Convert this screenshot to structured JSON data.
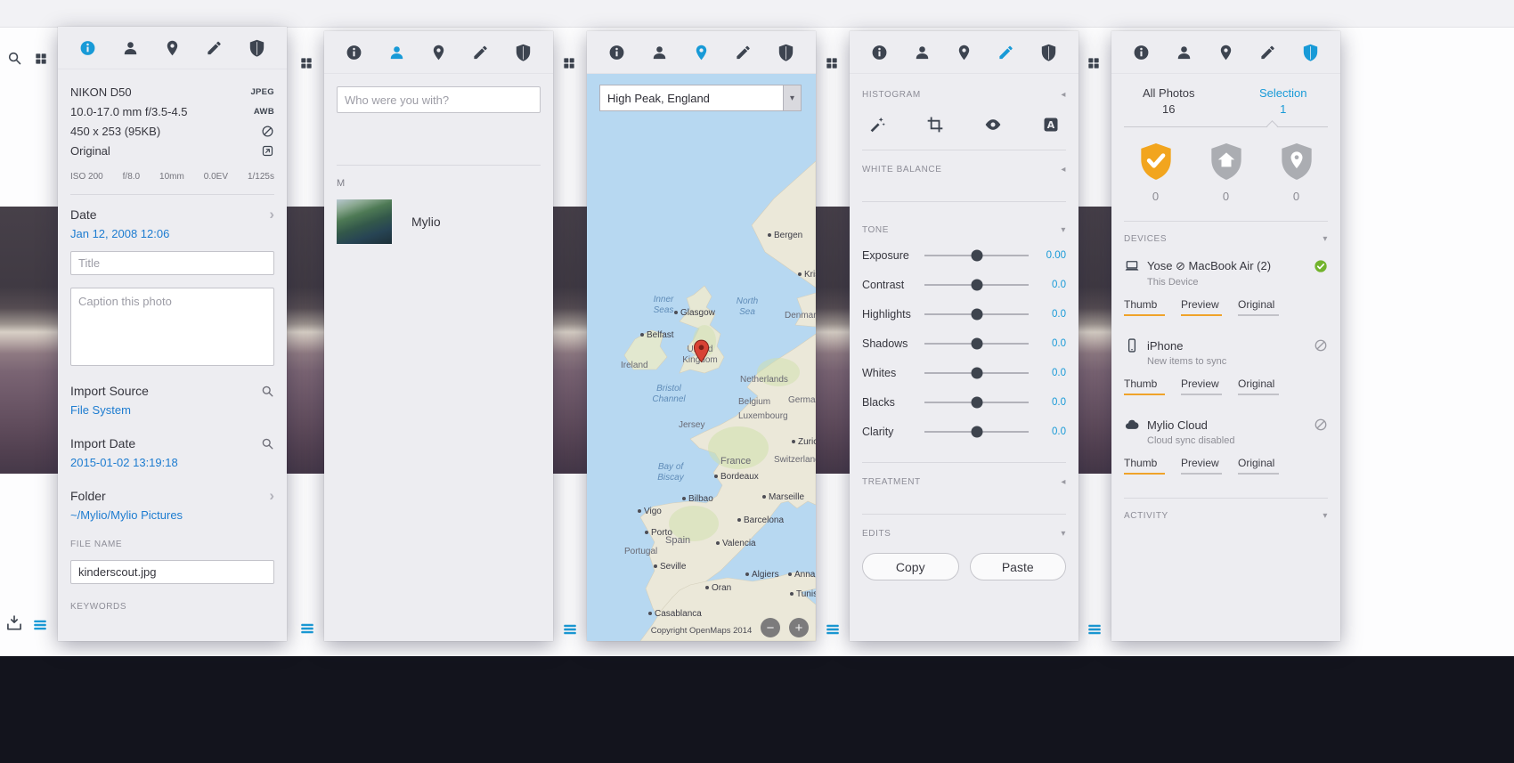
{
  "glyphs": {
    "chevron_right": "›",
    "caret_down": "▾",
    "caret_left": "◂",
    "plus": "+",
    "minus": "−"
  },
  "info": {
    "camera": "NIKON D50",
    "format_badge": "JPEG",
    "lens": "10.0-17.0 mm f/3.5-4.5",
    "wb_badge": "AWB",
    "dimensions": "450 x 253 (95KB)",
    "original_label": "Original",
    "exif": [
      "ISO 200",
      "f/8.0",
      "10mm",
      "0.0EV",
      "1/125s"
    ],
    "date_label": "Date",
    "date_value": "Jan 12, 2008 12:06",
    "title_placeholder": "Title",
    "caption_placeholder": "Caption this photo",
    "import_source_label": "Import Source",
    "import_source_value": "File System",
    "import_date_label": "Import Date",
    "import_date_value": "2015-01-02 13:19:18",
    "folder_label": "Folder",
    "folder_value": "~/Mylio/Mylio Pictures",
    "file_name_label": "FILE NAME",
    "file_name_value": "kinderscout.jpg",
    "keywords_label": "KEYWORDS"
  },
  "people": {
    "search_placeholder": "Who were you with?",
    "group_letter": "M",
    "person_name": "Mylio"
  },
  "map": {
    "location_value": "High Peak, England",
    "copyright": "Copyright OpenMaps 2014",
    "labels": [
      {
        "text": "Bergen"
      },
      {
        "text": "Kristiansand"
      },
      {
        "text": "Inner Seas"
      },
      {
        "text": "Glasgow"
      },
      {
        "text": "North Sea"
      },
      {
        "text": "Denmark"
      },
      {
        "text": "Belfast"
      },
      {
        "text": "United Kingdom"
      },
      {
        "text": "Ireland"
      },
      {
        "text": "Netherlands"
      },
      {
        "text": "Bristol Channel"
      },
      {
        "text": "Belgium"
      },
      {
        "text": "Luxembourg"
      },
      {
        "text": "Germany"
      },
      {
        "text": "Jersey"
      },
      {
        "text": "Zurich"
      },
      {
        "text": "France"
      },
      {
        "text": "Switzerland"
      },
      {
        "text": "Bay of Biscay"
      },
      {
        "text": "Bordeaux"
      },
      {
        "text": "Bilbao"
      },
      {
        "text": "Marseille"
      },
      {
        "text": "Vigo"
      },
      {
        "text": "Barcelona"
      },
      {
        "text": "Porto"
      },
      {
        "text": "Valencia"
      },
      {
        "text": "Spain"
      },
      {
        "text": "Portugal"
      },
      {
        "text": "Seville"
      },
      {
        "text": "Algiers"
      },
      {
        "text": "Annaba"
      },
      {
        "text": "Oran"
      },
      {
        "text": "Casablanca"
      },
      {
        "text": "Tunis"
      }
    ]
  },
  "edit": {
    "histogram_label": "HISTOGRAM",
    "white_balance_label": "WHITE BALANCE",
    "tone_label": "TONE",
    "treatment_label": "TREATMENT",
    "edits_label": "EDITS",
    "tone_sliders": [
      {
        "label": "Exposure",
        "value": "0.00"
      },
      {
        "label": "Contrast",
        "value": "0.0"
      },
      {
        "label": "Highlights",
        "value": "0.0"
      },
      {
        "label": "Shadows",
        "value": "0.0"
      },
      {
        "label": "Whites",
        "value": "0.0"
      },
      {
        "label": "Blacks",
        "value": "0.0"
      },
      {
        "label": "Clarity",
        "value": "0.0"
      }
    ],
    "copy_label": "Copy",
    "paste_label": "Paste"
  },
  "sync": {
    "all_photos_label": "All Photos",
    "all_photos_count": "16",
    "selection_label": "Selection",
    "selection_count": "1",
    "shield_counts": [
      "0",
      "0",
      "0"
    ],
    "devices_label": "DEVICES",
    "devices": [
      {
        "name": "Yose ⊘ MacBook Air (2)",
        "subtitle": "This Device",
        "q1": "Thumb",
        "q2": "Preview",
        "q3": "Original"
      },
      {
        "name": "iPhone",
        "subtitle": "New items to sync",
        "q1": "Thumb",
        "q2": "Preview",
        "q3": "Original"
      },
      {
        "name": "Mylio Cloud",
        "subtitle": "Cloud sync disabled",
        "q1": "Thumb",
        "q2": "Preview",
        "q3": "Original"
      }
    ],
    "activity_label": "ACTIVITY"
  },
  "colors": {
    "accent_blue": "#189ad7",
    "link_blue": "#1d7cd0",
    "shield_orange": "#f2a51e",
    "status_green": "#72b32d",
    "pin_red": "#d84335"
  }
}
